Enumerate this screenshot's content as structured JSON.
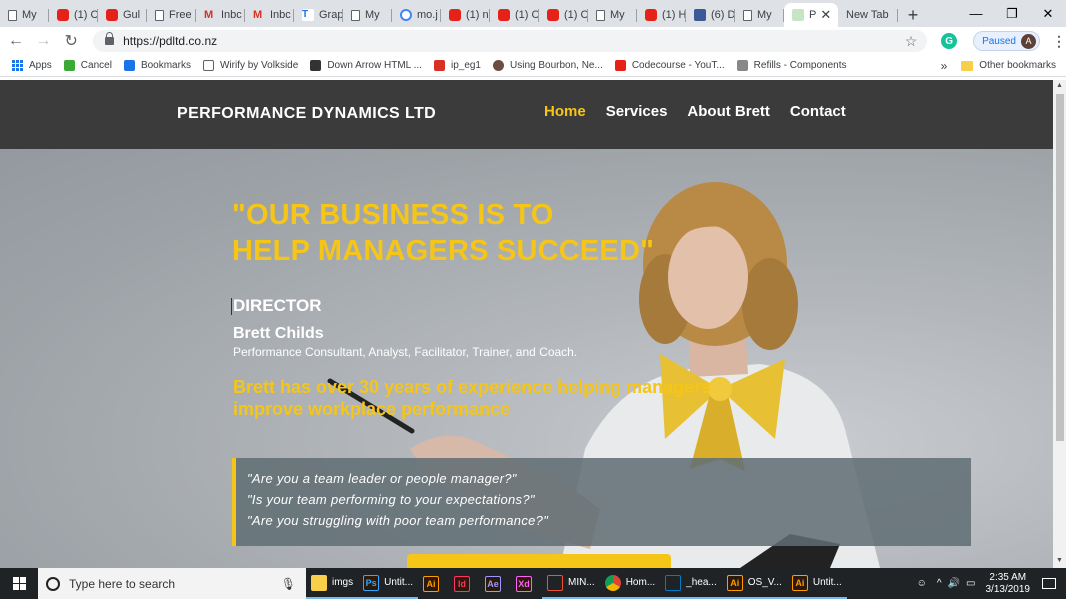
{
  "browser": {
    "tabs": [
      {
        "label": "My",
        "icon": "doc"
      },
      {
        "label": "(1) C",
        "icon": "yt"
      },
      {
        "label": "Gul",
        "icon": "yt"
      },
      {
        "label": "Free",
        "icon": "doc"
      },
      {
        "label": "Inbc",
        "icon": "gm"
      },
      {
        "label": "Inbc",
        "icon": "gm"
      },
      {
        "label": "Grap",
        "icon": "ggt"
      },
      {
        "label": "My",
        "icon": "doc"
      },
      {
        "label": "mo.j",
        "icon": "gg"
      },
      {
        "label": "(1) n",
        "icon": "yt"
      },
      {
        "label": "(1) C",
        "icon": "yt"
      },
      {
        "label": "(1) C",
        "icon": "yt"
      },
      {
        "label": "My",
        "icon": "doc"
      },
      {
        "label": "(1) H",
        "icon": "yt"
      },
      {
        "label": "(6) D",
        "icon": "fb"
      },
      {
        "label": "My",
        "icon": "doc"
      }
    ],
    "active_tab": {
      "label": "P",
      "close": "✕"
    },
    "new_tab_label": "New Tab",
    "new_tab_button": "+",
    "window_controls": {
      "minimize": "—",
      "restore": "❐",
      "close": "✕"
    },
    "url": "https://pdltd.co.nz",
    "paused_label": "Paused",
    "avatar_letter": "A",
    "bookmarks": [
      {
        "label": "Apps",
        "icon": "apps-grid"
      },
      {
        "label": "Cancel",
        "icon": "ip"
      },
      {
        "label": "Bookmarks",
        "icon": "star"
      },
      {
        "label": "Wirify by Volkside",
        "icon": "doc"
      },
      {
        "label": "Down Arrow HTML ...",
        "icon": "code"
      },
      {
        "label": "ip_eg1",
        "icon": "red"
      },
      {
        "label": "Using Bourbon, Ne...",
        "icon": "avatar"
      },
      {
        "label": "Codecourse - YouT...",
        "icon": "yt"
      },
      {
        "label": "Refills - Components",
        "icon": "refills"
      }
    ],
    "bookmarks_overflow": "»",
    "other_bookmarks": "Other bookmarks"
  },
  "site": {
    "brand": "PERFORMANCE DYNAMICS LTD",
    "nav": {
      "home": "Home",
      "services": "Services",
      "about": "About Brett",
      "contact": "Contact"
    },
    "hero": {
      "headline_line1": "\"OUR BUSINESS IS TO",
      "headline_line2": "HELP MANAGERS SUCCEED\"",
      "role": "DIRECTOR",
      "name": "Brett Childs",
      "description": "Performance Consultant, Analyst, Facilitator, Trainer, and Coach.",
      "experience_line1": "Brett has over 30 years of experience helping managers",
      "experience_line2": "improve workplace performance",
      "quotes": [
        "\"Are you a team leader or people manager?\"",
        "\"Is your team performing to your expectations?\"",
        "\"Are you struggling with poor team performance?\""
      ]
    }
  },
  "taskbar": {
    "search_placeholder": "Type here to search",
    "items": [
      {
        "label": "imgs",
        "icon": "folder",
        "color": "#f9ce4a"
      },
      {
        "label": "Untit...",
        "icon": "Ps",
        "color": "#31a8ff"
      },
      {
        "label": "",
        "icon": "Ai",
        "color": "#ff9a00"
      },
      {
        "label": "",
        "icon": "Id",
        "color": "#ff3366"
      },
      {
        "label": "",
        "icon": "Ae",
        "color": "#9999ff"
      },
      {
        "label": "",
        "icon": "Xd",
        "color": "#ff61f6"
      },
      {
        "label": "MIN...",
        "icon": "git",
        "color": "#f05033"
      },
      {
        "label": "Hom...",
        "icon": "chrome",
        "color": "#4caf50"
      },
      {
        "label": "_hea...",
        "icon": "vscode",
        "color": "#007acc"
      },
      {
        "label": "OS_V...",
        "icon": "Ai",
        "color": "#ff9a00"
      },
      {
        "label": "Untit...",
        "icon": "Ai",
        "color": "#ff9a00"
      }
    ],
    "time": "2:35 AM",
    "date": "3/13/2019"
  }
}
